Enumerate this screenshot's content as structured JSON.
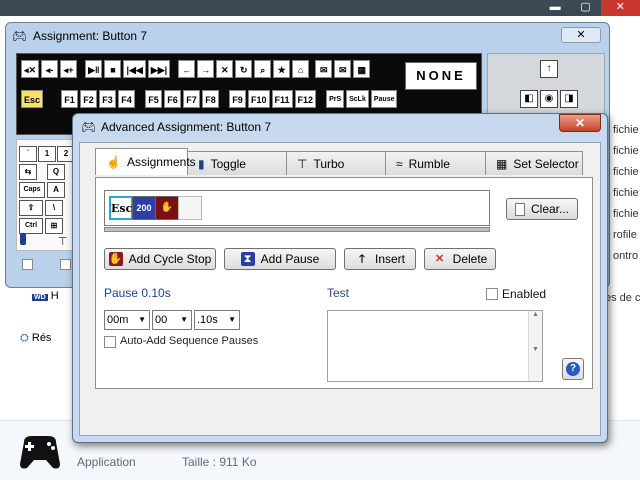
{
  "os": {
    "minimize": "▬",
    "maximize": "▢",
    "close": "✕"
  },
  "explorer": {
    "side_items": [
      "fichie",
      "fichie",
      "fichie",
      "fichie",
      "fichie",
      "rofile",
      "ontro",
      "es de c"
    ],
    "left_items": [
      {
        "icon": "wd-drive-icon",
        "glyph": "WD",
        "label": "H"
      },
      {
        "icon": "network-icon",
        "glyph": "⛭",
        "label": "Rés"
      }
    ],
    "bottom": {
      "type_label": "Application",
      "size_label": "Taille : 911 Ko"
    }
  },
  "back_window": {
    "title": "Assignment: Button 7",
    "close": "✕",
    "keyboard_row1": [
      "◂✕",
      "◂-",
      "◂+",
      "▶‖",
      "■",
      "|◀◀",
      "▶▶|",
      "←",
      "→",
      "✕",
      "↻",
      "⌕",
      "★",
      "⌂",
      "✉",
      "✉",
      "▦"
    ],
    "keyboard_row2": [
      "Esc",
      "F1",
      "F2",
      "F3",
      "F4",
      "F5",
      "F6",
      "F7",
      "F8",
      "F9",
      "F10",
      "F11",
      "F12",
      "PrS",
      "ScLk",
      "Pause"
    ],
    "none_label": "NONE",
    "mouse_keys": [
      "↑",
      "◧",
      "◉",
      "◨"
    ],
    "side_keys": [
      "`",
      "1",
      "2",
      "⇆",
      "Q",
      "Caps",
      "A",
      "⇧",
      "\\",
      "Ctrl",
      "⊞"
    ]
  },
  "dialog": {
    "title": "Advanced Assignment: Button 7",
    "close": "✕",
    "tabs": [
      {
        "label": "Assignments",
        "icon": "hand-pointer-icon",
        "glyph": "☝",
        "active": true
      },
      {
        "label": "Toggle",
        "icon": "toggle-icon",
        "glyph": "▮",
        "active": false
      },
      {
        "label": "Turbo",
        "icon": "turbo-icon",
        "glyph": "⊤",
        "active": false
      },
      {
        "label": "Rumble",
        "icon": "rumble-icon",
        "glyph": "≈",
        "active": false
      },
      {
        "label": "Set Selector",
        "icon": "set-selector-icon",
        "glyph": "▦",
        "active": false
      }
    ],
    "sequence": {
      "esc_label": "Esc",
      "pause_label": "200",
      "cycle_label": "✋"
    },
    "clear_label": "Clear...",
    "actions": {
      "add_cycle_stop": "Add Cycle Stop",
      "add_pause": "Add Pause",
      "insert": "Insert",
      "delete": "Delete"
    },
    "pause": {
      "label": "Pause 0.10s",
      "minutes": "00m",
      "seconds": "00",
      "fraction": ".10s",
      "auto_add_label": "Auto-Add Sequence Pauses"
    },
    "test": {
      "label": "Test",
      "enabled_label": "Enabled"
    },
    "help_label": "?"
  }
}
